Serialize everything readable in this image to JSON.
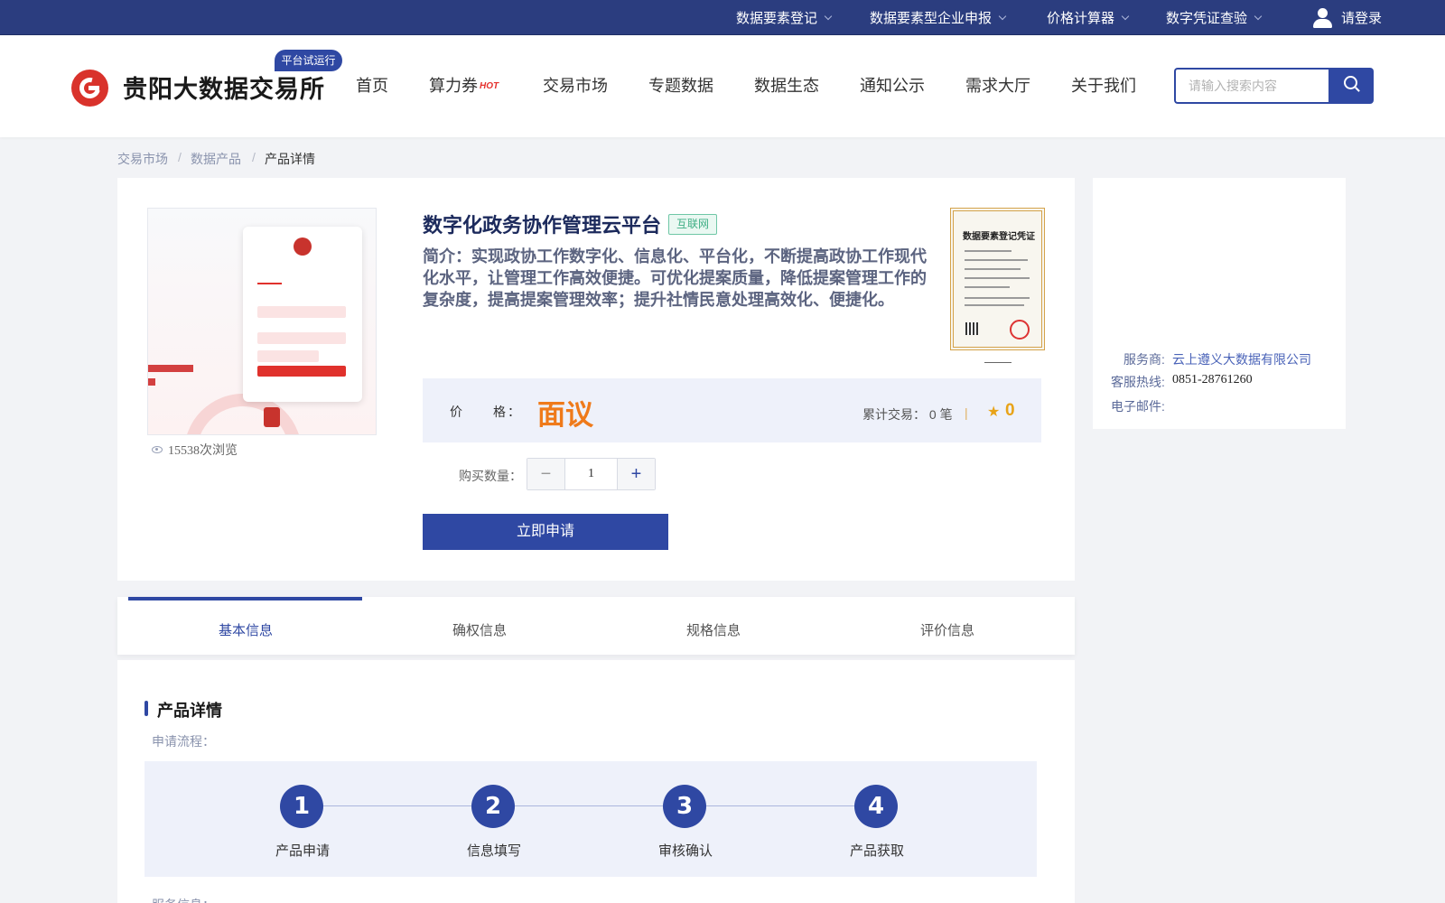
{
  "topbar": {
    "items": [
      {
        "label": "数据要素登记"
      },
      {
        "label": "数据要素型企业申报"
      },
      {
        "label": "价格计算器"
      },
      {
        "label": "数字凭证查验"
      }
    ],
    "login_label": "请登录"
  },
  "header": {
    "logo_text": "贵阳大数据交易所",
    "trial_badge": "平台试运行",
    "nav": [
      {
        "label": "首页"
      },
      {
        "label": "算力券"
      },
      {
        "label": "交易市场"
      },
      {
        "label": "专题数据"
      },
      {
        "label": "数据生态"
      },
      {
        "label": "通知公示"
      },
      {
        "label": "需求大厅"
      },
      {
        "label": "关于我们"
      }
    ],
    "hot_badge": "HOT",
    "search_placeholder": "请输入搜索内容"
  },
  "breadcrumb": {
    "items": [
      "交易市场",
      "数据产品",
      "产品详情"
    ],
    "separator": "/"
  },
  "product": {
    "title": "数字化政务协作管理云平台",
    "tag": "互联网",
    "intro": "简介：实现政协工作数字化、信息化、平台化，不断提高政协工作现代化水平，让管理工作高效便捷。可优化提案质量，降低提案管理工作的复杂度，提高提案管理效率；提升社情民意处理高效化、便捷化。",
    "views": "15538次浏览",
    "certificate_title": "数据要素登记凭证",
    "price_label": "价　　格：",
    "price_value": "面议",
    "deals": "累计交易：  0 笔",
    "divider": "|",
    "rating": "0",
    "quantity_label": "购买数量：",
    "quantity_value": "1",
    "apply_label": "立即申请"
  },
  "provider": {
    "service_label": "服务商:",
    "service_value": "云上遵义大数据有限公司",
    "hotline_label": "客服热线:",
    "hotline_value": "0851-28761260",
    "email_label": "电子邮件:"
  },
  "tabs": [
    {
      "label": "基本信息",
      "active": true
    },
    {
      "label": "确权信息",
      "active": false
    },
    {
      "label": "规格信息",
      "active": false
    },
    {
      "label": "评价信息",
      "active": false
    }
  ],
  "detail": {
    "section_title": "产品详情",
    "flow_label": "申请流程：",
    "steps": [
      {
        "num": "1",
        "label": "产品申请"
      },
      {
        "num": "2",
        "label": "信息填写"
      },
      {
        "num": "3",
        "label": "审核确认"
      },
      {
        "num": "4",
        "label": "产品获取"
      }
    ],
    "service_info_label": "服务信息："
  },
  "colors": {
    "primary": "#2f48a3",
    "topbar": "#2b3d7f",
    "price": "#ef7a1a",
    "tag": "#3fae85",
    "logo_red": "#d9322b"
  }
}
